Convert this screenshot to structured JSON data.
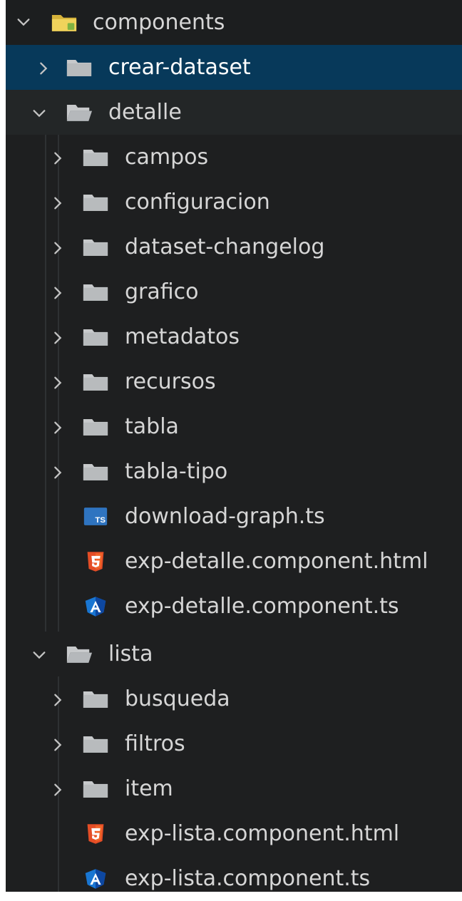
{
  "tree": [
    {
      "label": "components",
      "type": "folder",
      "state": "expanded",
      "icon": "components-folder-icon"
    },
    {
      "label": "crear-dataset",
      "type": "folder",
      "state": "collapsed",
      "icon": "folder-icon"
    },
    {
      "label": "detalle",
      "type": "folder",
      "state": "expanded",
      "icon": "folder-open-icon"
    },
    {
      "label": "campos",
      "type": "folder",
      "state": "collapsed",
      "icon": "folder-icon"
    },
    {
      "label": "configuracion",
      "type": "folder",
      "state": "collapsed",
      "icon": "folder-icon"
    },
    {
      "label": "dataset-changelog",
      "type": "folder",
      "state": "collapsed",
      "icon": "folder-icon"
    },
    {
      "label": "grafico",
      "type": "folder",
      "state": "collapsed",
      "icon": "folder-icon"
    },
    {
      "label": "metadatos",
      "type": "folder",
      "state": "collapsed",
      "icon": "folder-icon"
    },
    {
      "label": "recursos",
      "type": "folder",
      "state": "collapsed",
      "icon": "folder-icon"
    },
    {
      "label": "tabla",
      "type": "folder",
      "state": "collapsed",
      "icon": "folder-icon"
    },
    {
      "label": "tabla-tipo",
      "type": "folder",
      "state": "collapsed",
      "icon": "folder-icon"
    },
    {
      "label": "download-graph.ts",
      "type": "file",
      "icon": "typescript-file-icon"
    },
    {
      "label": "exp-detalle.component.html",
      "type": "file",
      "icon": "html5-file-icon"
    },
    {
      "label": "exp-detalle.component.ts",
      "type": "file",
      "icon": "angular-file-icon"
    },
    {
      "label": "lista",
      "type": "folder",
      "state": "expanded",
      "icon": "folder-open-icon"
    },
    {
      "label": "busqueda",
      "type": "folder",
      "state": "collapsed",
      "icon": "folder-icon"
    },
    {
      "label": "filtros",
      "type": "folder",
      "state": "collapsed",
      "icon": "folder-icon"
    },
    {
      "label": "item",
      "type": "folder",
      "state": "collapsed",
      "icon": "folder-icon"
    },
    {
      "label": "exp-lista.component.html",
      "type": "file",
      "icon": "html5-file-icon"
    },
    {
      "label": "exp-lista.component.ts",
      "type": "file",
      "icon": "angular-file-icon"
    }
  ],
  "selected_item": "crear-dataset",
  "colors": {
    "background": "#1e1f20",
    "selection": "#07395a",
    "text": "#d6d6d6",
    "folder": "#c7c9cb",
    "components_folder": "#e6c84c",
    "typescript": "#2f74c0",
    "html5": "#e44d26",
    "angular": "#1976d2"
  }
}
